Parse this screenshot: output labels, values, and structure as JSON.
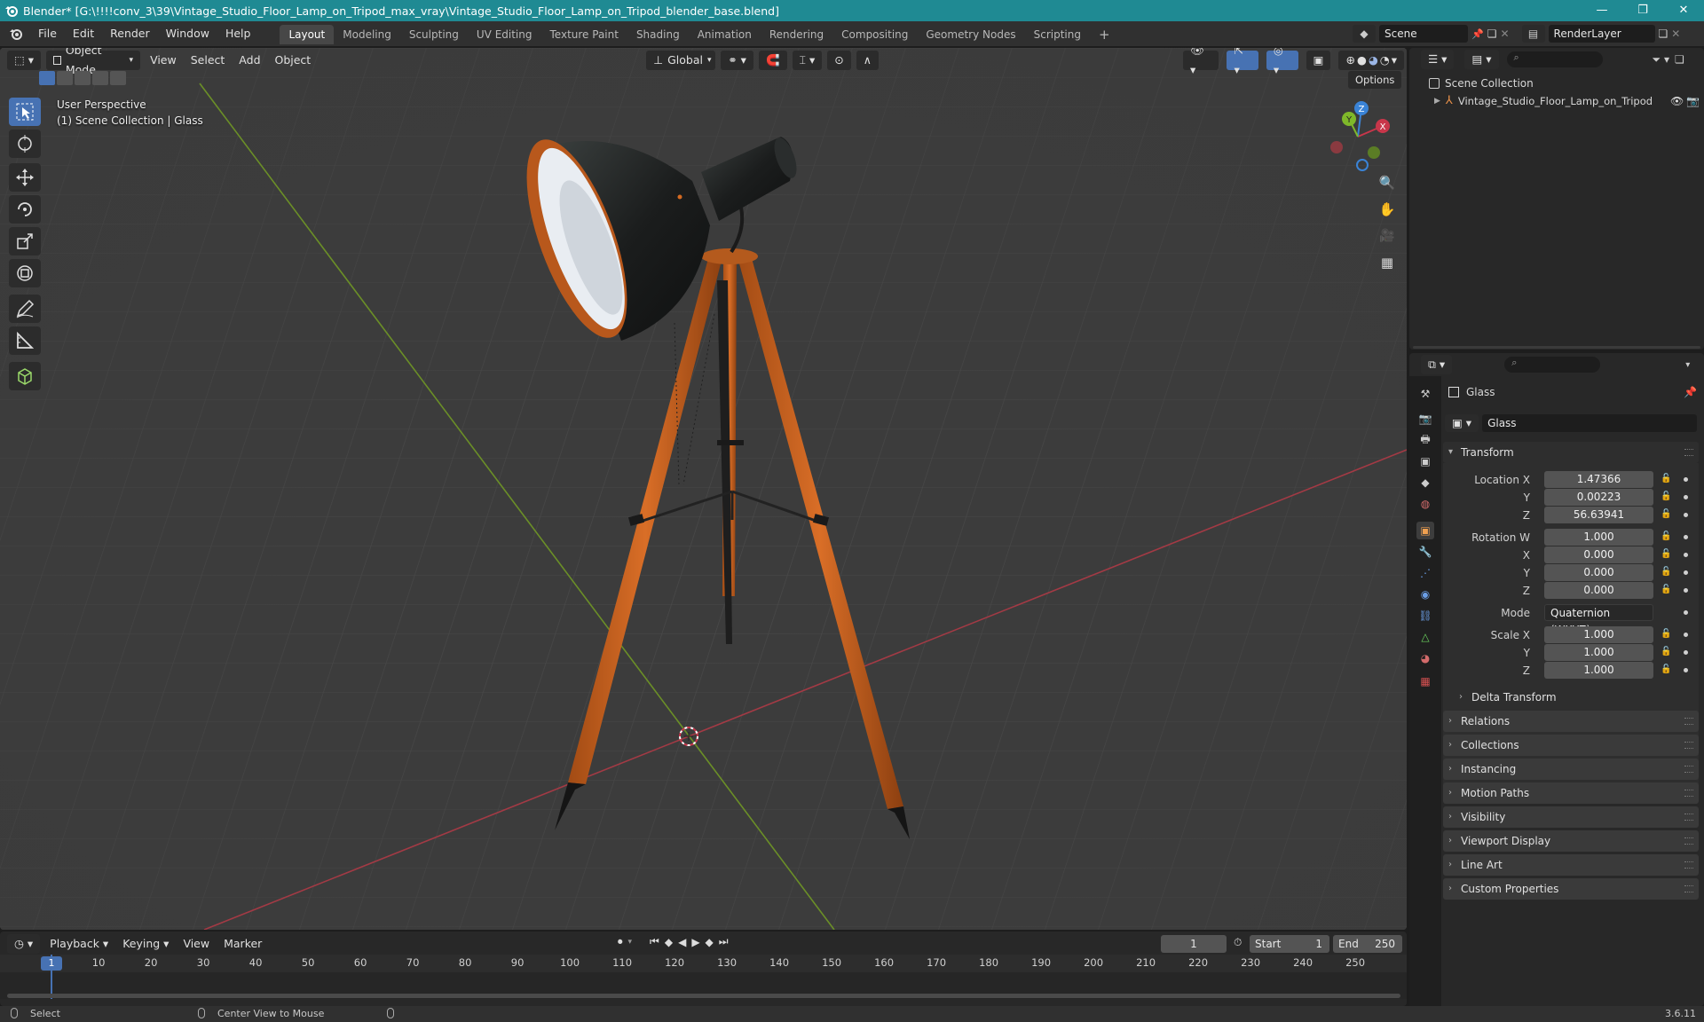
{
  "window": {
    "title": "Blender* [G:\\!!!!conv_3\\39\\Vintage_Studio_Floor_Lamp_on_Tripod_max_vray\\Vintage_Studio_Floor_Lamp_on_Tripod_blender_base.blend]",
    "minimize": "—",
    "restore": "❐",
    "close": "✕"
  },
  "menu": [
    "File",
    "Edit",
    "Render",
    "Window",
    "Help"
  ],
  "workspaces": [
    "Layout",
    "Modeling",
    "Sculpting",
    "UV Editing",
    "Texture Paint",
    "Shading",
    "Animation",
    "Rendering",
    "Compositing",
    "Geometry Nodes",
    "Scripting",
    "+"
  ],
  "scene": "Scene",
  "render_layer": "RenderLayer",
  "viewport": {
    "mode": "Object Mode",
    "menus": [
      "View",
      "Select",
      "Add",
      "Object"
    ],
    "transform_orientation": "Global",
    "options": "Options",
    "overlay_line1": "User Perspective",
    "overlay_line2": "(1) Scene Collection | Glass",
    "gizmo": {
      "x": "X",
      "y": "Y",
      "z": "Z"
    }
  },
  "outliner": {
    "root": "Scene Collection",
    "items": [
      {
        "label": "Vintage_Studio_Floor_Lamp_on_Tripod"
      }
    ]
  },
  "properties": {
    "object_name": "Glass",
    "data_name": "Glass",
    "transform_title": "Transform",
    "location": {
      "label_x": "Location X",
      "label_y": "Y",
      "label_z": "Z",
      "x": "1.47366",
      "y": "0.00223",
      "z": "56.63941"
    },
    "rotation": {
      "label_w": "Rotation W",
      "label_x": "X",
      "label_y": "Y",
      "label_z": "Z",
      "w": "1.000",
      "x": "0.000",
      "y": "0.000",
      "z": "0.000"
    },
    "mode_label": "Mode",
    "mode_value": "Quaternion (WXYZ)",
    "scale": {
      "label_x": "Scale X",
      "label_y": "Y",
      "label_z": "Z",
      "x": "1.000",
      "y": "1.000",
      "z": "1.000"
    },
    "delta_transform": "Delta Transform",
    "panels": [
      "Relations",
      "Collections",
      "Instancing",
      "Motion Paths",
      "Visibility",
      "Viewport Display",
      "Line Art",
      "Custom Properties"
    ]
  },
  "timeline": {
    "menus": [
      "Playback",
      "Keying",
      "View",
      "Marker"
    ],
    "current_frame": "1",
    "start_label": "Start",
    "start": "1",
    "end_label": "End",
    "end": "250",
    "ruler": [
      "1",
      "10",
      "20",
      "30",
      "40",
      "50",
      "60",
      "70",
      "80",
      "90",
      "100",
      "110",
      "120",
      "130",
      "140",
      "150",
      "160",
      "170",
      "180",
      "190",
      "200",
      "210",
      "220",
      "230",
      "240",
      "250"
    ]
  },
  "status": {
    "select": "Select",
    "center_view": "Center View to Mouse",
    "version": "3.6.11"
  },
  "colors": {
    "accent": "#4772b3",
    "titlebar": "#1f8a93",
    "x_axis": "#c8364a",
    "y_axis": "#7fb82a",
    "z_axis": "#3a83d6"
  }
}
